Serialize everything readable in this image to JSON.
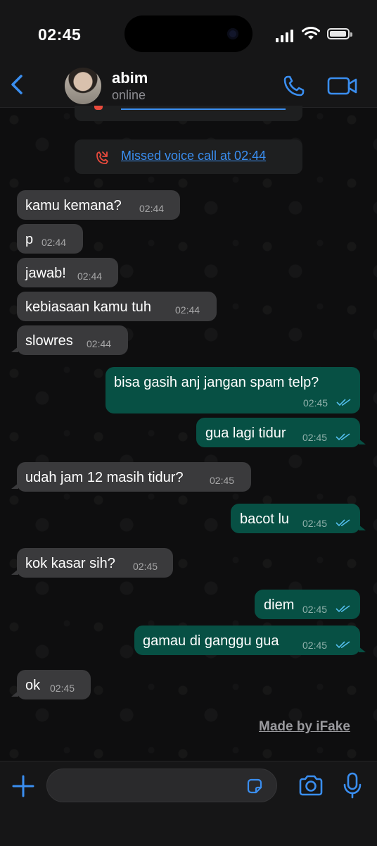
{
  "status_bar": {
    "time": "02:45"
  },
  "header": {
    "contact_name": "abim",
    "contact_status": "online"
  },
  "system_messages": {
    "missed_call": "Missed voice call at 02:44"
  },
  "messages": [
    {
      "direction": "incoming",
      "text": "kamu kemana?",
      "time": "02:44"
    },
    {
      "direction": "incoming",
      "text": "p",
      "time": "02:44"
    },
    {
      "direction": "incoming",
      "text": "jawab!",
      "time": "02:44"
    },
    {
      "direction": "incoming",
      "text": "kebiasaan kamu tuh",
      "time": "02:44"
    },
    {
      "direction": "incoming",
      "text": "slowres",
      "time": "02:44"
    },
    {
      "direction": "outgoing",
      "text": "bisa gasih anj jangan spam telp?",
      "time": "02:45",
      "read": true
    },
    {
      "direction": "outgoing",
      "text": "gua lagi tidur",
      "time": "02:45",
      "read": true
    },
    {
      "direction": "incoming",
      "text": "udah jam 12 masih tidur?",
      "time": "02:45"
    },
    {
      "direction": "outgoing",
      "text": "bacot lu",
      "time": "02:45",
      "read": true
    },
    {
      "direction": "incoming",
      "text": "kok kasar sih?",
      "time": "02:45"
    },
    {
      "direction": "outgoing",
      "text": "diem",
      "time": "02:45",
      "read": true
    },
    {
      "direction": "outgoing",
      "text": "gamau di ganggu gua",
      "time": "02:45",
      "read": true
    },
    {
      "direction": "incoming",
      "text": "ok",
      "time": "02:45"
    }
  ],
  "watermark": "Made by iFake",
  "icons": {
    "back": "chevron-left-icon",
    "call": "phone-icon",
    "video": "video-camera-icon",
    "missed_call": "missed-call-icon",
    "attach": "plus-icon",
    "sticker": "sticker-icon",
    "camera": "camera-icon",
    "mic": "microphone-icon"
  },
  "colors": {
    "accent": "#3a8ef0",
    "incoming_bubble": "#3a3a3c",
    "outgoing_bubble": "#075044",
    "missed_call_red": "#e84a3c",
    "read_ticks": "#53bdeb"
  }
}
